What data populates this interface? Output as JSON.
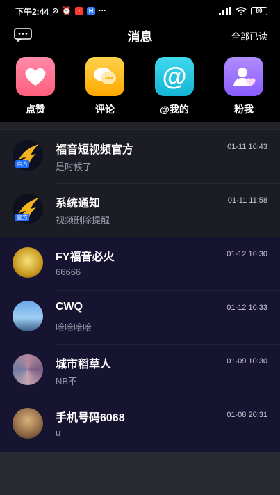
{
  "status_bar": {
    "time": "下午2:44",
    "left_icons": [
      "mute-icon",
      "alarm-icon",
      "app-badge-red-icon",
      "app-badge-blue-icon",
      "more-dots-icon"
    ],
    "battery": "80",
    "right_icons": [
      "signal-icon",
      "wifi-icon",
      "battery-icon"
    ]
  },
  "nav": {
    "title": "消息",
    "left_icon": "chat-bubble-icon",
    "right_label": "全部已读"
  },
  "quick_actions": [
    {
      "label": "点赞",
      "icon": "heart-icon",
      "color": "#ff6f88"
    },
    {
      "label": "评论",
      "icon": "comment-icon",
      "color": "#ffb000"
    },
    {
      "label": "@我的",
      "icon": "at-icon",
      "color": "#1ec9e0"
    },
    {
      "label": "粉我",
      "icon": "person-heart-icon",
      "color": "#9a6bff"
    }
  ],
  "messages": [
    {
      "name": "福音短视频官方",
      "preview": "是时候了",
      "time": "01-11 16:43",
      "badge": "官方",
      "type": "official"
    },
    {
      "name": "系统通知",
      "preview": "视频删除提醒",
      "time": "01-11 11:58",
      "badge": "官方",
      "type": "official"
    },
    {
      "name": "FY福音必火",
      "preview": "66666",
      "time": "01-12 16:30",
      "badge": "",
      "type": "user"
    },
    {
      "name": "CWQ",
      "preview": "哈哈哈哈",
      "time": "01-12 10:33",
      "badge": "",
      "type": "user"
    },
    {
      "name": "城市稻草人",
      "preview": "NB不",
      "time": "01-09 10:30",
      "badge": "",
      "type": "user"
    },
    {
      "name": "手机号码6068",
      "preview": "u",
      "time": "01-08 20:31",
      "badge": "",
      "type": "user"
    }
  ],
  "colors": {
    "background": "#000000",
    "panel": "#2a2b31",
    "official_row": "#1b1c24",
    "user_row": "#171432",
    "badge_blue": "#1e6bff"
  }
}
